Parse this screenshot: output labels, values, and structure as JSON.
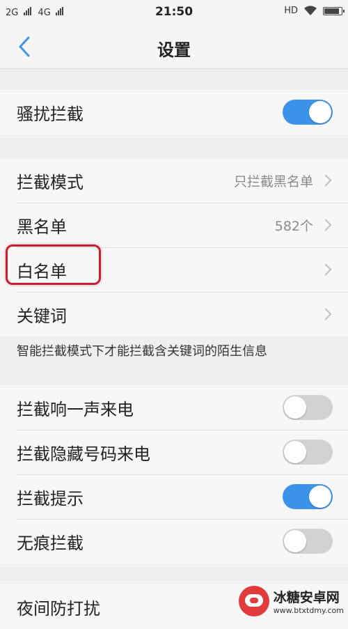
{
  "status_bar": {
    "sim1": "2G",
    "sim2": "4G",
    "time": "21:50",
    "hd": "HD"
  },
  "header": {
    "title": "设置",
    "back_icon": "chevron-left-icon"
  },
  "colors": {
    "accent": "#3c93ea",
    "highlight": "#c81f2e",
    "toggle_off": "#d2d2d4"
  },
  "sections": {
    "harassment": {
      "label": "骚扰拦截",
      "enabled": true
    },
    "lists": [
      {
        "label": "拦截模式",
        "value": "只拦截黑名单"
      },
      {
        "label": "黑名单",
        "value": "582个"
      },
      {
        "label": "白名单",
        "value": ""
      },
      {
        "label": "关键词",
        "value": ""
      }
    ],
    "note": "智能拦截模式下才能拦截含关键词的陌生信息",
    "toggles": [
      {
        "label": "拦截响一声来电",
        "enabled": false
      },
      {
        "label": "拦截隐藏号码来电",
        "enabled": false
      },
      {
        "label": "拦截提示",
        "enabled": true
      },
      {
        "label": "无痕拦截",
        "enabled": false
      }
    ],
    "night": {
      "label": "夜间防打扰"
    }
  },
  "watermark": {
    "title": "冰糖安卓网",
    "url": "www.btxtdmy.com"
  }
}
